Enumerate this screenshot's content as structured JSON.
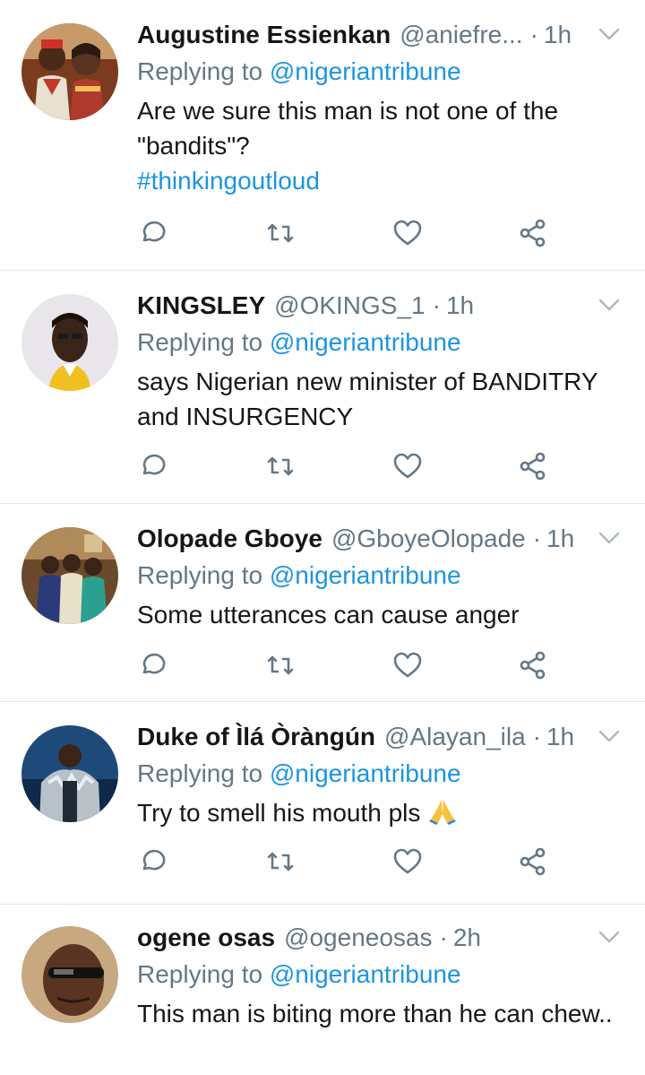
{
  "colors": {
    "link": "#1b95e0",
    "secondary": "#657786",
    "primary": "#14171a",
    "divider": "#e1e8ed"
  },
  "tweets": [
    {
      "name": "Augustine Essienkan",
      "handle": "@aniefre...",
      "dot": "·",
      "time": "1h",
      "replying_prefix": "Replying to",
      "replying_to": "@nigeriantribune",
      "text": "Are we sure this man is not one of the \"bandits\"?",
      "hashtag": "#thinkingoutloud",
      "avatar": "couple-photo"
    },
    {
      "name": "KINGSLEY",
      "handle": "@OKINGS_1",
      "dot": "·",
      "time": "1h",
      "replying_prefix": "Replying to",
      "replying_to": "@nigeriantribune",
      "text": "says Nigerian new minister of BANDITRY and INSURGENCY",
      "avatar": "man-portrait"
    },
    {
      "name": "Olopade Gboye",
      "handle": "@GboyeOlopade",
      "dot": "·",
      "time": "1h",
      "replying_prefix": "Replying to",
      "replying_to": "@nigeriantribune",
      "text": "Some utterances can cause anger",
      "avatar": "group-photo"
    },
    {
      "name": "Duke of Ìlá Òràngún",
      "handle": "@Alayan_ila",
      "dot": "·",
      "time": "1h",
      "replying_prefix": "Replying to",
      "replying_to": "@nigeriantribune",
      "text": "Try to smell his mouth pls",
      "emoji": "folded-hands",
      "avatar": "fur-cloak-portrait"
    },
    {
      "name": "ogene osas",
      "handle": "@ogeneosas",
      "dot": "·",
      "time": "2h",
      "replying_prefix": "Replying to",
      "replying_to": "@nigeriantribune",
      "text": "This man is biting more than he can chew..",
      "avatar": "sunglasses-portrait"
    }
  ],
  "action_icons": [
    "reply-icon",
    "retweet-icon",
    "like-icon",
    "share-icon"
  ]
}
